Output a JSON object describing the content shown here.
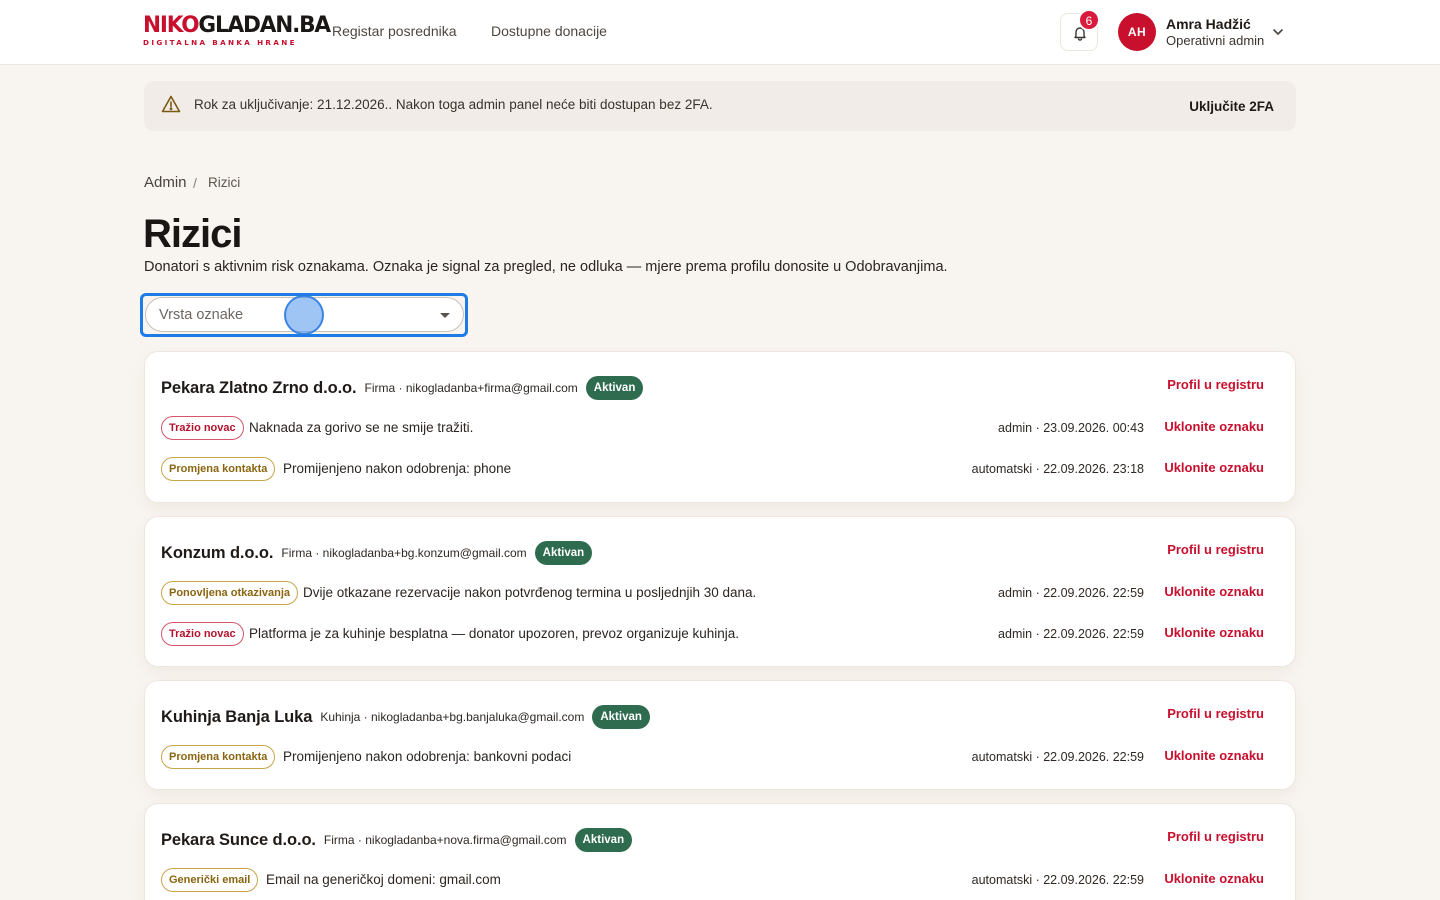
{
  "header": {
    "logo_main_a": "NIKO",
    "logo_main_b": "GLADAN.BA",
    "logo_tagline": "DIGITALNA BANKA HRANE",
    "nav": [
      "Registar posrednika",
      "Dostupne donacije"
    ],
    "notifications_count": "6",
    "user": {
      "initials": "AH",
      "name": "Amra Hadžić",
      "role": "Operativni admin"
    }
  },
  "banner": {
    "text": "Rok za uključivanje: 21.12.2026.. Nakon toga admin panel neće biti dostupan bez 2FA.",
    "action": "Uključite 2FA"
  },
  "breadcrumb": {
    "root": "Admin",
    "separator": "/",
    "current": "Rizici"
  },
  "page": {
    "title": "Rizici",
    "subtitle": "Donatori s aktivnim risk oznakama. Oznaka je signal za pregled, ne odluka — mjere prema profilu donosite u Odobravanjima."
  },
  "filter": {
    "placeholder": "Vrsta oznake"
  },
  "colors": {
    "brand": "#c8102e",
    "status_active": "#2f6b4f",
    "focus_ring": "#1e7be6"
  },
  "donors": [
    {
      "name": "Pekara Zlatno Zrno d.o.o.",
      "meta": "Firma · nikogladanba+firma@gmail.com",
      "status": "Aktivan",
      "profile_link": "Profil u registru",
      "flags": [
        {
          "tag": "Tražio novac",
          "tone": "red",
          "text": "Naknada za gorivo se ne smije tražiti.",
          "by": "admin · 23.09.2026. 00:43",
          "remove": "Uklonite oznaku"
        },
        {
          "tag": "Promjena kontakta",
          "tone": "gold",
          "text": "Promijenjeno nakon odobrenja: phone",
          "by": "automatski · 22.09.2026. 23:18",
          "remove": "Uklonite oznaku"
        }
      ]
    },
    {
      "name": "Konzum d.o.o.",
      "meta": "Firma · nikogladanba+bg.konzum@gmail.com",
      "status": "Aktivan",
      "profile_link": "Profil u registru",
      "flags": [
        {
          "tag": "Ponovljena otkazivanja",
          "tone": "gold",
          "text": "Dvije otkazane rezervacije nakon potvrđenog termina u posljednjih 30 dana.",
          "by": "admin · 22.09.2026. 22:59",
          "remove": "Uklonite oznaku"
        },
        {
          "tag": "Tražio novac",
          "tone": "red",
          "text": "Platforma je za kuhinje besplatna — donator upozoren, prevoz organizuje kuhinja.",
          "by": "admin · 22.09.2026. 22:59",
          "remove": "Uklonite oznaku"
        }
      ]
    },
    {
      "name": "Kuhinja Banja Luka",
      "meta": "Kuhinja · nikogladanba+bg.banjaluka@gmail.com",
      "status": "Aktivan",
      "profile_link": "Profil u registru",
      "flags": [
        {
          "tag": "Promjena kontakta",
          "tone": "gold",
          "text": "Promijenjeno nakon odobrenja: bankovni podaci",
          "by": "automatski · 22.09.2026. 22:59",
          "remove": "Uklonite oznaku"
        }
      ]
    },
    {
      "name": "Pekara Sunce d.o.o.",
      "meta": "Firma · nikogladanba+nova.firma@gmail.com",
      "status": "Aktivan",
      "profile_link": "Profil u registru",
      "flags": [
        {
          "tag": "Generički email",
          "tone": "gold",
          "text": "Email na generičkoj domeni: gmail.com",
          "by": "automatski · 22.09.2026. 22:59",
          "remove": "Uklonite oznaku"
        }
      ]
    }
  ]
}
